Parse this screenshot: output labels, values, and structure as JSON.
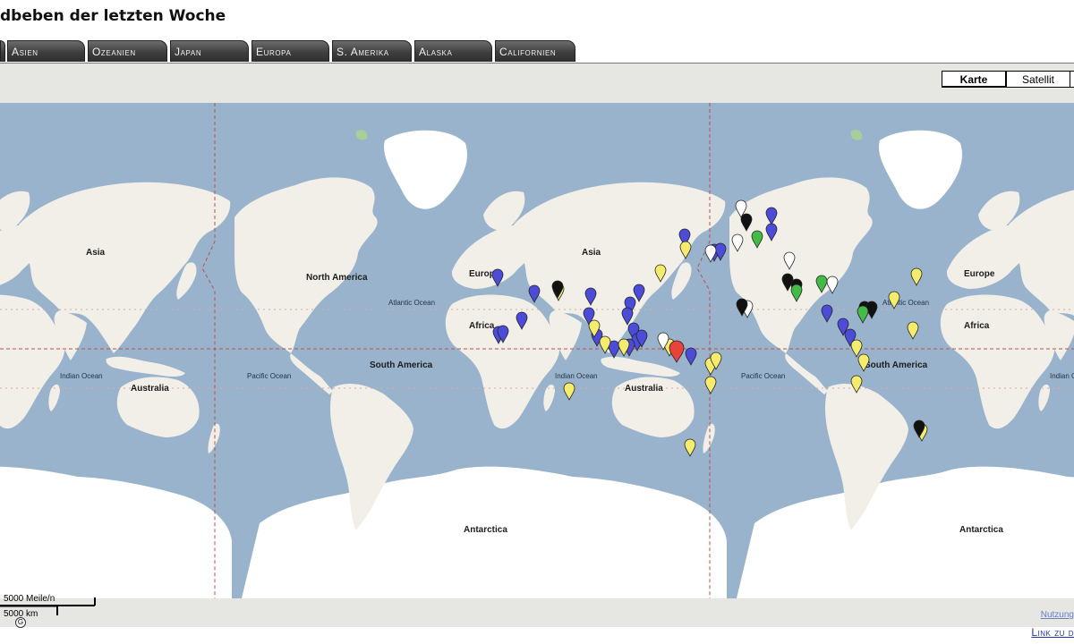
{
  "page": {
    "title": "dbeben der letzten Woche",
    "link_bottom": "Link zu d"
  },
  "tabs": [
    {
      "label": "Asien"
    },
    {
      "label": "Ozeanien"
    },
    {
      "label": "Japan"
    },
    {
      "label": "Europa"
    },
    {
      "label": "S. Amerika"
    },
    {
      "label": "Alaska"
    },
    {
      "label": "Californien"
    }
  ],
  "map": {
    "type_buttons": [
      {
        "label": "Karte",
        "active": true
      },
      {
        "label": "Satellit",
        "active": false
      }
    ],
    "scale": {
      "miles": "5000 Meile/n",
      "km": "5000 km"
    },
    "terms_link": "Nutzung",
    "colors": {
      "ocean": "#99b3cc",
      "land": "#f2efe8",
      "ice": "#ffffff",
      "grid": "#b9524b",
      "marker_blue": "#4c4cd8",
      "marker_yellow": "#f5ec6e",
      "marker_white": "#ffffff",
      "marker_black": "#111111",
      "marker_green": "#44bb44",
      "marker_red": "#e8423a"
    },
    "labels": {
      "asia": "Asia",
      "europe": "Europe",
      "africa": "Africa",
      "australia": "Australia",
      "north_america": "North America",
      "south_america": "South America",
      "antarctica": "Antarctica",
      "atlantic": "Atlantic Ocean",
      "pacific": "Pacific Ocean",
      "indian": "Indian Ocean"
    }
  }
}
